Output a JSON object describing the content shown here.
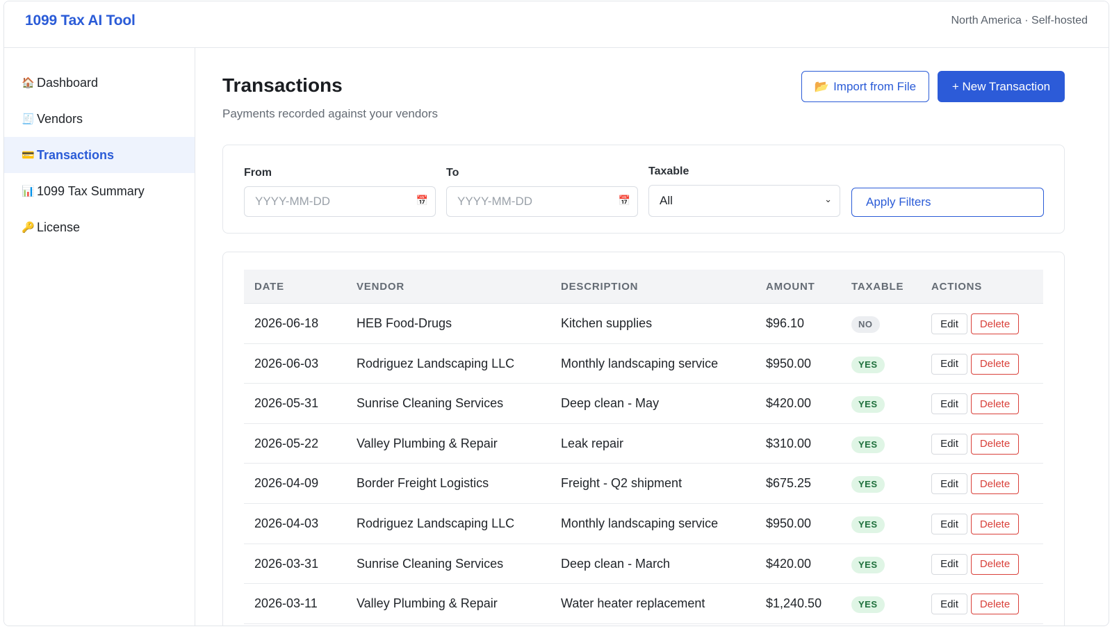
{
  "app": {
    "brand": "1099 Tax AI Tool",
    "region": "North America · Self-hosted"
  },
  "sidebar": {
    "items": [
      {
        "icon": "🏠",
        "icon_name": "house-icon",
        "label": "Dashboard",
        "active": false
      },
      {
        "icon": "🧾",
        "icon_name": "receipt-icon",
        "label": "Vendors",
        "active": false
      },
      {
        "icon": "💳",
        "icon_name": "credit-card-icon",
        "label": "Transactions",
        "active": true
      },
      {
        "icon": "📊",
        "icon_name": "bar-chart-icon",
        "label": "1099 Tax Summary",
        "active": false
      },
      {
        "icon": "🔑",
        "icon_name": "key-icon",
        "label": "License",
        "active": false
      }
    ]
  },
  "page": {
    "title": "Transactions",
    "subtitle": "Payments recorded against your vendors",
    "import_icon": "📂",
    "import_label": "Import from File",
    "new_label": "+ New Transaction"
  },
  "filters": {
    "from_label": "From",
    "from_placeholder": "YYYY-MM-DD",
    "to_label": "To",
    "to_placeholder": "YYYY-MM-DD",
    "calendar_icon": "📅",
    "taxable_label": "Taxable",
    "taxable_value": "All",
    "apply_label": "Apply Filters"
  },
  "table": {
    "headers": [
      "DATE",
      "VENDOR",
      "DESCRIPTION",
      "AMOUNT",
      "TAXABLE",
      "ACTIONS"
    ],
    "edit_label": "Edit",
    "delete_label": "Delete",
    "rows": [
      {
        "date": "2026-06-18",
        "vendor": "HEB Food-Drugs",
        "description": "Kitchen supplies",
        "amount": "$96.10",
        "taxable": "NO"
      },
      {
        "date": "2026-06-03",
        "vendor": "Rodriguez Landscaping LLC",
        "description": "Monthly landscaping service",
        "amount": "$950.00",
        "taxable": "YES"
      },
      {
        "date": "2026-05-31",
        "vendor": "Sunrise Cleaning Services",
        "description": "Deep clean - May",
        "amount": "$420.00",
        "taxable": "YES"
      },
      {
        "date": "2026-05-22",
        "vendor": "Valley Plumbing & Repair",
        "description": "Leak repair",
        "amount": "$310.00",
        "taxable": "YES"
      },
      {
        "date": "2026-04-09",
        "vendor": "Border Freight Logistics",
        "description": "Freight - Q2 shipment",
        "amount": "$675.25",
        "taxable": "YES"
      },
      {
        "date": "2026-04-03",
        "vendor": "Rodriguez Landscaping LLC",
        "description": "Monthly landscaping service",
        "amount": "$950.00",
        "taxable": "YES"
      },
      {
        "date": "2026-03-31",
        "vendor": "Sunrise Cleaning Services",
        "description": "Deep clean - March",
        "amount": "$420.00",
        "taxable": "YES"
      },
      {
        "date": "2026-03-11",
        "vendor": "Valley Plumbing & Repair",
        "description": "Water heater replacement",
        "amount": "$1,240.50",
        "taxable": "YES"
      }
    ]
  },
  "colors": {
    "accent": "#2a5bd7",
    "danger": "#d9403a",
    "yes_bg": "#dff5e5",
    "yes_fg": "#1d6f3b",
    "no_bg": "#eceef1"
  }
}
